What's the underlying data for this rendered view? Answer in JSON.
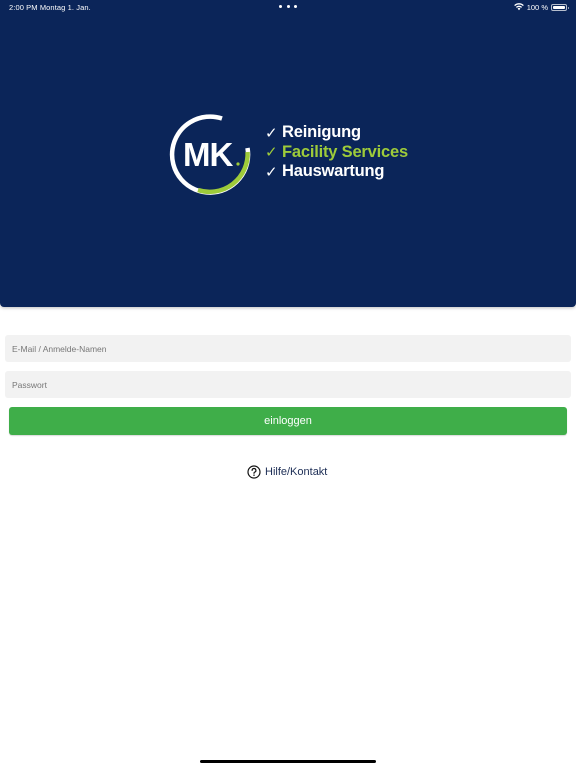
{
  "status_bar": {
    "time_date": "2:00 PM  Montag 1. Jan.",
    "battery_label": "100 %",
    "wifi_icon": "wifi-icon",
    "battery_icon": "battery-icon"
  },
  "logo": {
    "monogram": "MK",
    "lines": [
      {
        "check": "✓",
        "text": "Reinigung"
      },
      {
        "check": "✓",
        "text": "Facility Services"
      },
      {
        "check": "✓",
        "text": "Hauswartung"
      }
    ],
    "colors": {
      "navy": "#0b2559",
      "green": "#9ecb3a",
      "white": "#ffffff"
    }
  },
  "login_form": {
    "email_placeholder": "E-Mail / Anmelde-Namen",
    "email_value": "",
    "password_placeholder": "Passwort",
    "password_value": "",
    "submit_label": "einloggen",
    "submit_color": "#3fae49"
  },
  "help": {
    "label": "Hilfe/Kontakt",
    "icon": "question-circle-icon"
  }
}
